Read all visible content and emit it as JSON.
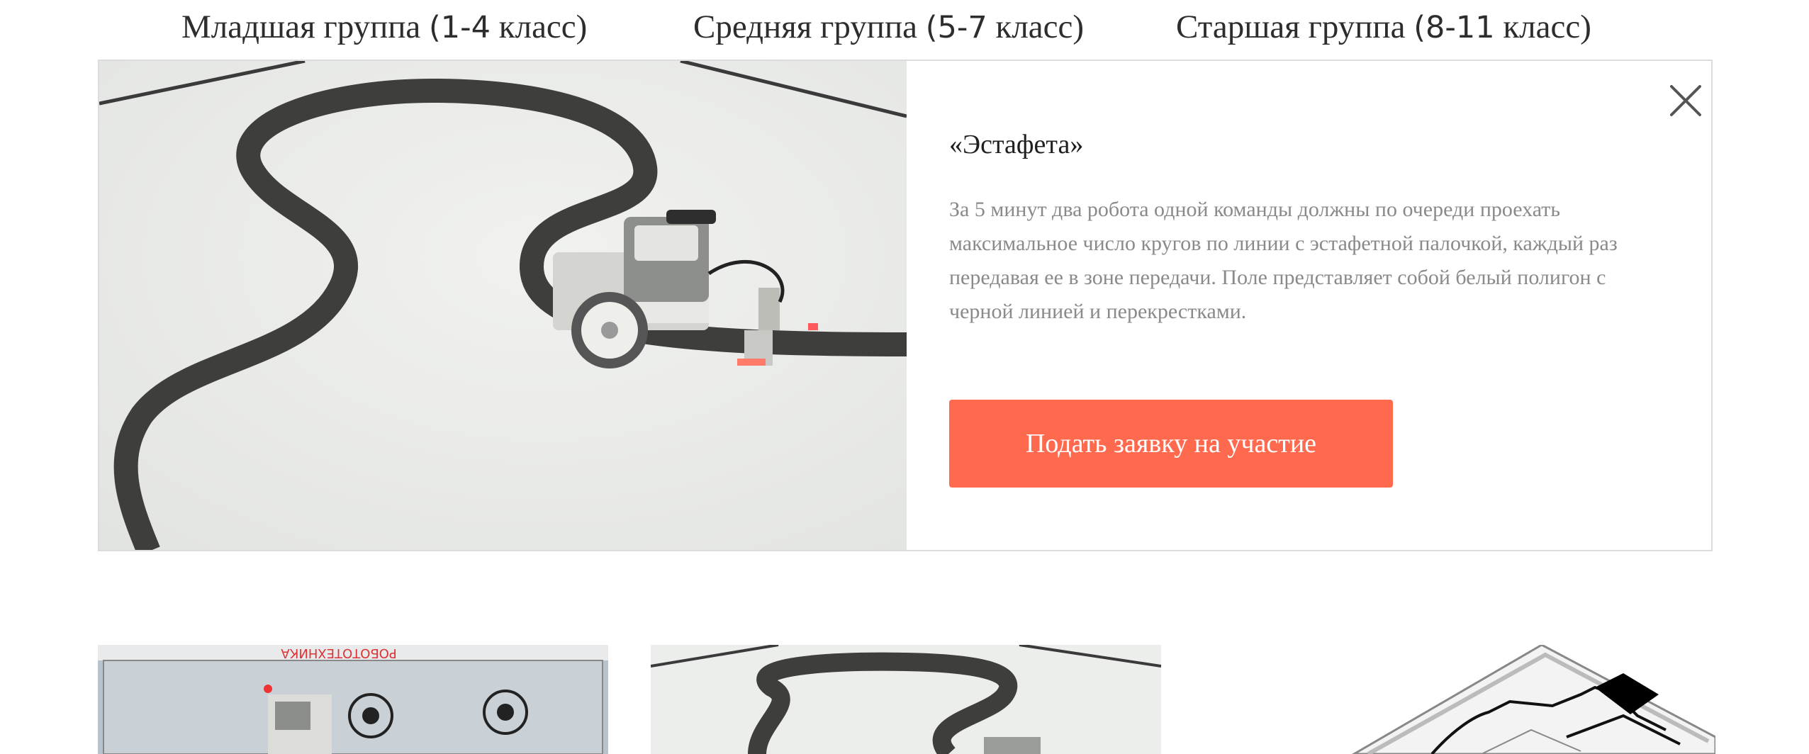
{
  "tabs": [
    {
      "label_text": "Младшая группа ",
      "label_num": "(1-4",
      "label_tail": " класс)"
    },
    {
      "label_text": "Средняя группа ",
      "label_num": "(5-7",
      "label_tail": " класс)"
    },
    {
      "label_text": "Старшая группа ",
      "label_num": "(8-11",
      "label_tail": " класс)"
    }
  ],
  "popup": {
    "title": "«Эстафета»",
    "description": "За 5 минут два робота одной команды должны по очереди проехать максимальное число кругов по линии с эстафетной палочкой, каждый раз передавая ее в зоне передачи. Поле представляет собой белый полигон с черной линией и перекрестками.",
    "button_label": "Подать заявку на участие",
    "button_color": "#ff6a4f",
    "close_icon": "close-icon"
  },
  "thumbnails": [
    {
      "field_label": "РОБОТОТЕХНИКА"
    },
    {},
    {}
  ]
}
